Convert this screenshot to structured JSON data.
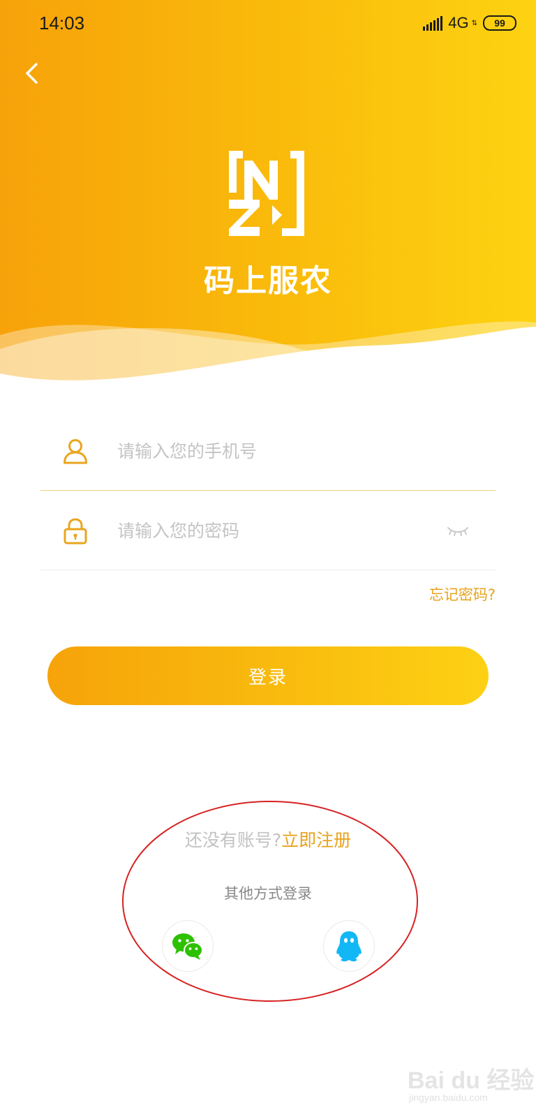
{
  "colors": {
    "brand_orange": "#F7A20A",
    "brand_yellow": "#FDD312",
    "accent_text": "#E8A21D",
    "annotation_red": "#D62222"
  },
  "status_bar": {
    "time": "14:03",
    "network": "4G",
    "battery": "99"
  },
  "header": {
    "app_name": "码上服农",
    "back_icon": "chevron-left-icon"
  },
  "form": {
    "phone": {
      "placeholder": "请输入您的手机号",
      "value": "",
      "icon": "user-icon"
    },
    "password": {
      "placeholder": "请输入您的密码",
      "value": "",
      "icon": "lock-icon",
      "toggle_icon": "eye-closed-icon"
    },
    "forgot_password": "忘记密码?",
    "login_button": "登录"
  },
  "register": {
    "prompt": "还没有账号?",
    "link": "立即注册"
  },
  "other_login": {
    "label": "其他方式登录",
    "providers": [
      {
        "name": "WeChat",
        "icon": "wechat-icon"
      },
      {
        "name": "QQ",
        "icon": "qq-icon"
      }
    ]
  },
  "watermark": {
    "brand": "Bai du 经验",
    "url": "jingyan.baidu.com"
  }
}
